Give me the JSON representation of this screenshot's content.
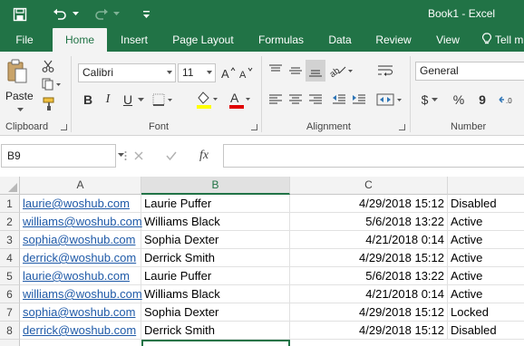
{
  "window": {
    "title": "Book1 - Excel"
  },
  "qat": {
    "save_icon": "save-icon",
    "undo_icon": "undo-icon",
    "redo_icon": "redo-icon",
    "customize_icon": "customize-qat-icon"
  },
  "ribbon_tabs": [
    "File",
    "Home",
    "Insert",
    "Page Layout",
    "Formulas",
    "Data",
    "Review",
    "View",
    "Tell m"
  ],
  "active_tab": "Home",
  "clipboard": {
    "paste_label": "Paste",
    "group_label": "Clipboard"
  },
  "font": {
    "family": "Calibri",
    "size": "11",
    "bold": "B",
    "italic": "I",
    "underline": "U",
    "group_label": "Font",
    "highlight_color": "#ffff00",
    "font_color": "#e00000"
  },
  "alignment": {
    "group_label": "Alignment"
  },
  "number": {
    "format": "General",
    "currency": "$",
    "percent": "%",
    "comma": "9",
    "group_label": "Number"
  },
  "formula_bar": {
    "name_box": "B9",
    "fx": "fx",
    "value": ""
  },
  "sheet": {
    "columns": [
      "A",
      "B",
      "C"
    ],
    "selected_column": "B",
    "rows": [
      {
        "num": "1",
        "a": "laurie@woshub.com",
        "b": "Laurie Puffer",
        "c": "4/29/2018 15:12",
        "d": "Disabled"
      },
      {
        "num": "2",
        "a": "williams@woshub.com",
        "b": "Williams Black",
        "c": "5/6/2018 13:22",
        "d": "Active"
      },
      {
        "num": "3",
        "a": "sophia@woshub.com",
        "b": "Sophia Dexter",
        "c": "4/21/2018 0:14",
        "d": "Active"
      },
      {
        "num": "4",
        "a": "derrick@woshub.com",
        "b": "Derrick Smith",
        "c": "4/29/2018 15:12",
        "d": "Active"
      },
      {
        "num": "5",
        "a": "laurie@woshub.com",
        "b": "Laurie Puffer",
        "c": "5/6/2018 13:22",
        "d": "Active"
      },
      {
        "num": "6",
        "a": "williams@woshub.com",
        "b": "Williams Black",
        "c": "4/21/2018 0:14",
        "d": "Active"
      },
      {
        "num": "7",
        "a": "sophia@woshub.com",
        "b": "Sophia Dexter",
        "c": "4/29/2018 15:12",
        "d": "Locked"
      },
      {
        "num": "8",
        "a": "derrick@woshub.com",
        "b": "Derrick Smith",
        "c": "4/29/2018 15:12",
        "d": "Disabled"
      }
    ]
  },
  "colors": {
    "brand": "#217346",
    "hyperlink": "#1f5aa8"
  }
}
